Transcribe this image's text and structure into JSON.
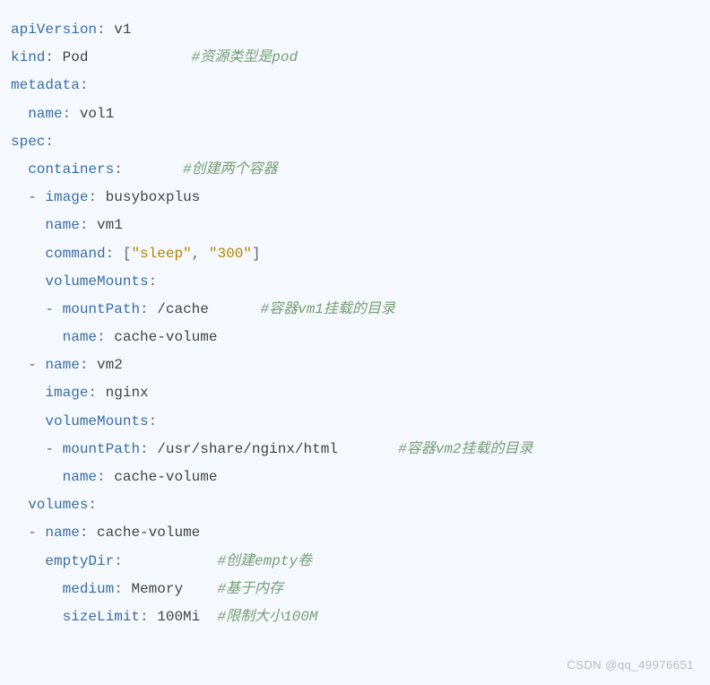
{
  "yaml": {
    "apiVersion": {
      "key": "apiVersion",
      "value": "v1"
    },
    "kind": {
      "key": "kind",
      "value": "Pod",
      "comment": "#资源类型是pod"
    },
    "metadata": {
      "key": "metadata",
      "name_key": "name",
      "name_value": "vol1"
    },
    "spec": {
      "key": "spec",
      "containers_key": "containers",
      "containers_comment": "#创建两个容器",
      "c1": {
        "image_key": "image",
        "image_value": "busyboxplus",
        "name_key": "name",
        "name_value": "vm1",
        "command_key": "command",
        "command_arr": [
          "\"sleep\"",
          "\"300\""
        ],
        "vm_key": "volumeMounts",
        "mount": {
          "mountPath_key": "mountPath",
          "mountPath_value": "/cache",
          "mount_comment": "#容器vm1挂载的目录",
          "name_key": "name",
          "name_value": "cache-volume"
        }
      },
      "c2": {
        "name_key": "name",
        "name_value": "vm2",
        "image_key": "image",
        "image_value": "nginx",
        "vm_key": "volumeMounts",
        "mount": {
          "mountPath_key": "mountPath",
          "mountPath_value": "/usr/share/nginx/html",
          "mount_comment": "#容器vm2挂载的目录",
          "name_key": "name",
          "name_value": "cache-volume"
        }
      },
      "volumes_key": "volumes",
      "vol": {
        "name_key": "name",
        "name_value": "cache-volume",
        "emptyDir_key": "emptyDir",
        "emptyDir_comment": "#创建empty卷",
        "medium_key": "medium",
        "medium_value": "Memory",
        "medium_comment": "#基于内存",
        "size_key": "sizeLimit",
        "size_value": "100Mi",
        "size_comment": "#限制大小100M"
      }
    }
  },
  "watermark": "CSDN @qq_49976651"
}
